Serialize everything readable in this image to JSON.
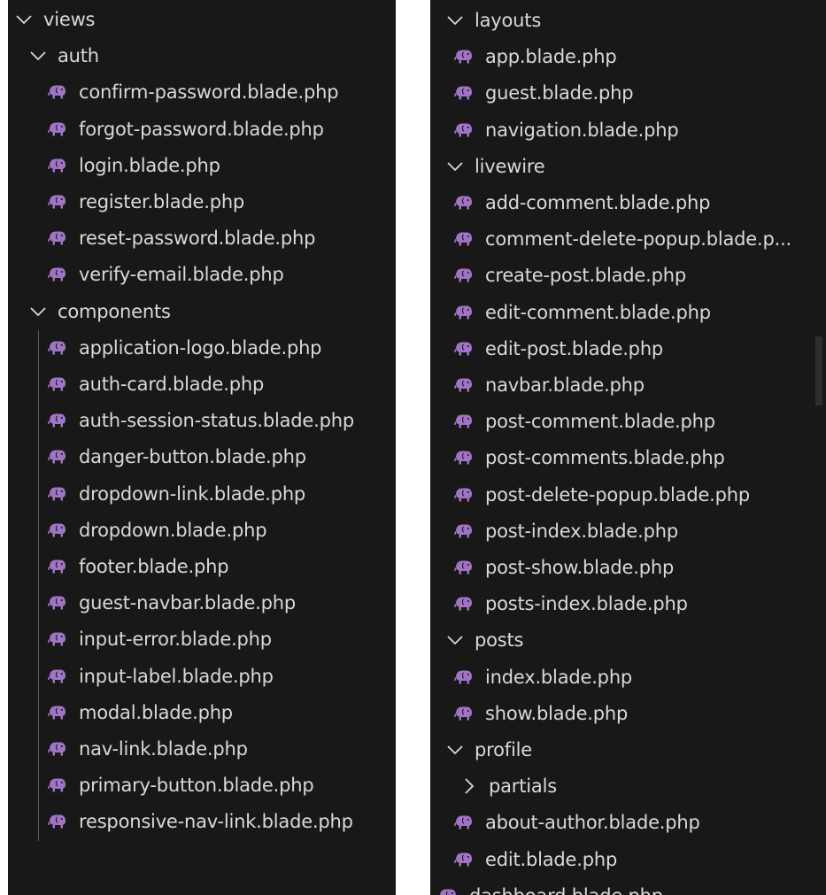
{
  "left": {
    "views_label": "views",
    "auth_label": "auth",
    "auth_files": [
      "confirm-password.blade.php",
      "forgot-password.blade.php",
      "login.blade.php",
      "register.blade.php",
      "reset-password.blade.php",
      "verify-email.blade.php"
    ],
    "components_label": "components",
    "components_files": [
      "application-logo.blade.php",
      "auth-card.blade.php",
      "auth-session-status.blade.php",
      "danger-button.blade.php",
      "dropdown-link.blade.php",
      "dropdown.blade.php",
      "footer.blade.php",
      "guest-navbar.blade.php",
      "input-error.blade.php",
      "input-label.blade.php",
      "modal.blade.php",
      "nav-link.blade.php",
      "primary-button.blade.php",
      "responsive-nav-link.blade.php"
    ]
  },
  "right": {
    "layouts_label": "layouts",
    "layouts_files": [
      "app.blade.php",
      "guest.blade.php",
      "navigation.blade.php"
    ],
    "livewire_label": "livewire",
    "livewire_files": [
      "add-comment.blade.php",
      "comment-delete-popup.blade.p...",
      "create-post.blade.php",
      "edit-comment.blade.php",
      "edit-post.blade.php",
      "navbar.blade.php",
      "post-comment.blade.php",
      "post-comments.blade.php",
      "post-delete-popup.blade.php",
      "post-index.blade.php",
      "post-show.blade.php",
      "posts-index.blade.php"
    ],
    "posts_label": "posts",
    "posts_files": [
      "index.blade.php",
      "show.blade.php"
    ],
    "profile_label": "profile",
    "partials_label": "partials",
    "profile_files": [
      "about-author.blade.php",
      "edit.blade.php"
    ],
    "dashboard_file": "dashboard.blade.php"
  },
  "colors": {
    "background": "#181818",
    "text": "#d9d9d9",
    "php_icon": "#a074c4",
    "indent_guide": "#585858"
  },
  "icons": {
    "folder_open": "chevron-down-icon",
    "folder_closed": "chevron-right-icon",
    "file": "php-elephant-icon"
  }
}
